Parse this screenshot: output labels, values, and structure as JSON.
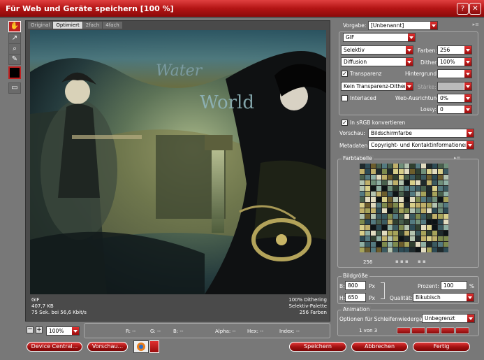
{
  "window": {
    "title": "Für Web und Geräte speichern [100 %]"
  },
  "preview": {
    "tabs": [
      "Original",
      "Optimiert",
      "2fach",
      "4fach"
    ],
    "active_tab": "Optimiert",
    "image_text_line1": "Water",
    "image_text_line2": "World",
    "info_left": [
      "GIF",
      "407,7 KB",
      "75 Sek. bei 56,6 Kbit/s"
    ],
    "info_right": [
      "100% Dithering",
      "Selektiv-Palette",
      "256 Farben"
    ]
  },
  "bottom_status": {
    "zoom": "100%",
    "r": "R: --",
    "g": "G: --",
    "b": "B: --",
    "alpha": "Alpha: --",
    "hex": "Hex: --",
    "index": "Index: --"
  },
  "buttons": {
    "device_central": "Device Central...",
    "preview": "Vorschau...",
    "save": "Speichern",
    "cancel": "Abbrechen",
    "done": "Fertig"
  },
  "settings": {
    "preset_label": "Vorgabe:",
    "preset_value": "[Unbenannt]",
    "format": "GIF",
    "reduction": "Selektiv",
    "colors_label": "Farben:",
    "colors_value": "256",
    "dither_algo": "Diffusion",
    "dither_label": "Dither:",
    "dither_value": "100%",
    "transparency_label": "Transparenz",
    "transparency_checked": true,
    "matte_label": "Hintergrund:",
    "transparency_dither": "Kein Transparenz-Dither",
    "amount_label": "Stärke:",
    "interlaced_label": "Interlaced",
    "interlaced_checked": false,
    "web_snap_label": "Web-Ausrichtung:",
    "web_snap_value": "0%",
    "lossy_label": "Lossy:",
    "lossy_value": "0",
    "srgb_label": "In sRGB konvertieren",
    "srgb_checked": true,
    "preview_label": "Vorschau:",
    "preview_value": "Bildschirmfarbe",
    "metadata_label": "Metadaten:",
    "metadata_value": "Copyright- und Kontaktinformationen"
  },
  "color_table": {
    "title": "Farbtabelle",
    "count": "256"
  },
  "image_size": {
    "title": "Bildgröße",
    "w_label": "B:",
    "w_value": "800",
    "h_label": "H:",
    "h_value": "650",
    "unit": "Px",
    "percent_label": "Prozent:",
    "percent_value": "100",
    "percent_unit": "%",
    "quality_label": "Qualität:",
    "quality_value": "Bikubisch"
  },
  "animation": {
    "title": "Animation",
    "loop_label": "Optionen für Schleifenwiedergabe:",
    "loop_value": "Unbegrenzt",
    "frame_counter": "1 von 3"
  },
  "colors": {
    "title_red": "#b31414",
    "button_red": "#a01010",
    "panel_gray": "#7c7c7c"
  }
}
